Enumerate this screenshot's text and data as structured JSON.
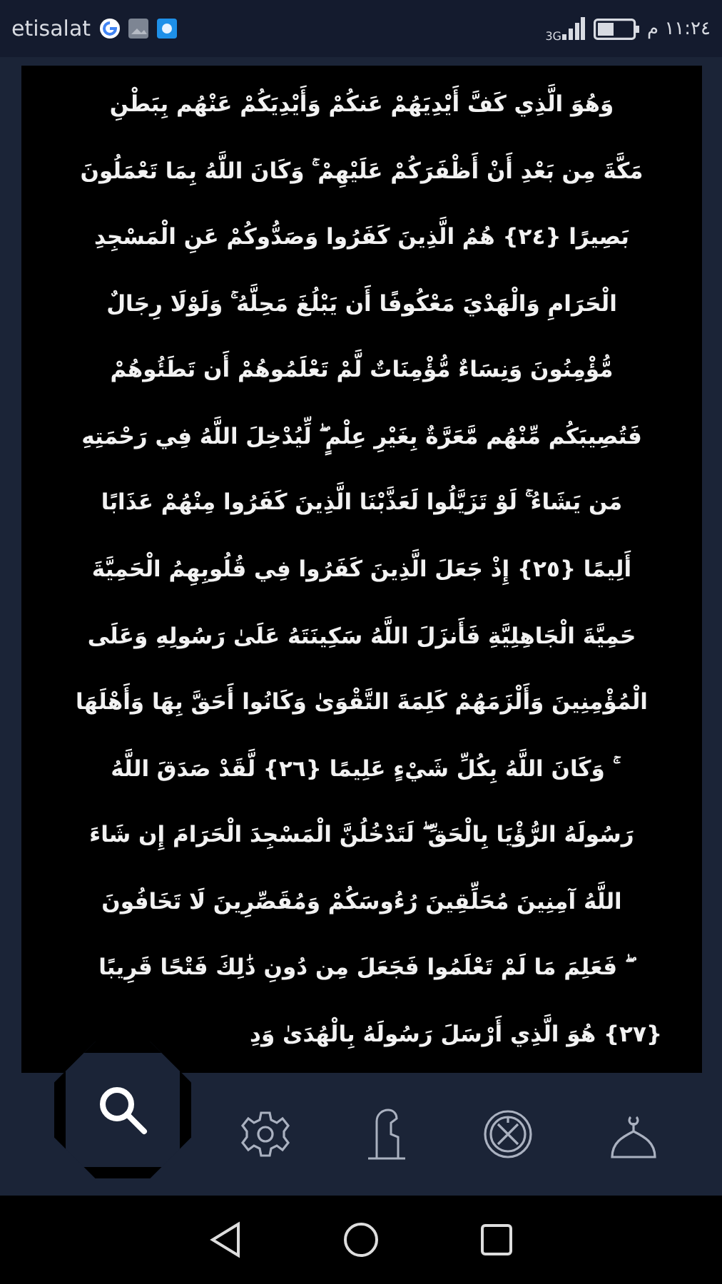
{
  "status_bar": {
    "carrier": "etisalat",
    "network": "3G",
    "time": "١١:٢٤ م"
  },
  "verse_lines": [
    "وَهُوَ الَّذِي كَفَّ أَيْدِيَهُمْ عَنكُمْ وَأَيْدِيَكُمْ عَنْهُم بِبَطْنِ",
    "مَكَّةَ مِن بَعْدِ أَنْ أَظْفَرَكُمْ عَلَيْهِمْ ۚ وَكَانَ اللَّهُ بِمَا تَعْمَلُونَ",
    "بَصِيرًا {٢٤} هُمُ الَّذِينَ كَفَرُوا وَصَدُّوكُمْ عَنِ الْمَسْجِدِ",
    "الْحَرَامِ وَالْهَدْيَ مَعْكُوفًا أَن يَبْلُغَ مَحِلَّهُ ۚ وَلَوْلَا رِجَالٌ",
    "مُّؤْمِنُونَ وَنِسَاءٌ مُّؤْمِنَاتٌ لَّمْ تَعْلَمُوهُمْ أَن تَطَئُوهُمْ",
    "فَتُصِيبَكُم مِّنْهُم مَّعَرَّةٌ بِغَيْرِ عِلْمٍ ۖ لِّيُدْخِلَ اللَّهُ فِي رَحْمَتِهِ",
    "مَن يَشَاءُ ۚ لَوْ تَزَيَّلُوا لَعَذَّبْنَا الَّذِينَ كَفَرُوا مِنْهُمْ عَذَابًا",
    "أَلِيمًا {٢٥} إِذْ جَعَلَ الَّذِينَ كَفَرُوا فِي قُلُوبِهِمُ الْحَمِيَّةَ",
    "حَمِيَّةَ الْجَاهِلِيَّةِ فَأَنزَلَ اللَّهُ سَكِينَتَهُ عَلَىٰ رَسُولِهِ وَعَلَى",
    "الْمُؤْمِنِينَ وَأَلْزَمَهُمْ كَلِمَةَ التَّقْوَىٰ وَكَانُوا أَحَقَّ بِهَا وَأَهْلَهَا",
    "ۚ وَكَانَ اللَّهُ بِكُلِّ شَيْءٍ عَلِيمًا {٢٦} لَّقَدْ صَدَقَ اللَّهُ",
    "رَسُولَهُ الرُّؤْيَا بِالْحَقِّ ۖ لَتَدْخُلُنَّ الْمَسْجِدَ الْحَرَامَ إِن شَاءَ",
    "اللَّهُ آمِنِينَ مُحَلِّقِينَ رُءُوسَكُمْ وَمُقَصِّرِينَ لَا تَخَافُونَ",
    "ۖ فَعَلِمَ مَا لَمْ تَعْلَمُوا فَجَعَلَ مِن دُونِ ذَٰلِكَ فَتْحًا قَرِيبًا",
    "{٢٧} هُوَ الَّذِي أَرْسَلَ رَسُولَهُ بِالْهُدَىٰ وَدِ"
  ]
}
